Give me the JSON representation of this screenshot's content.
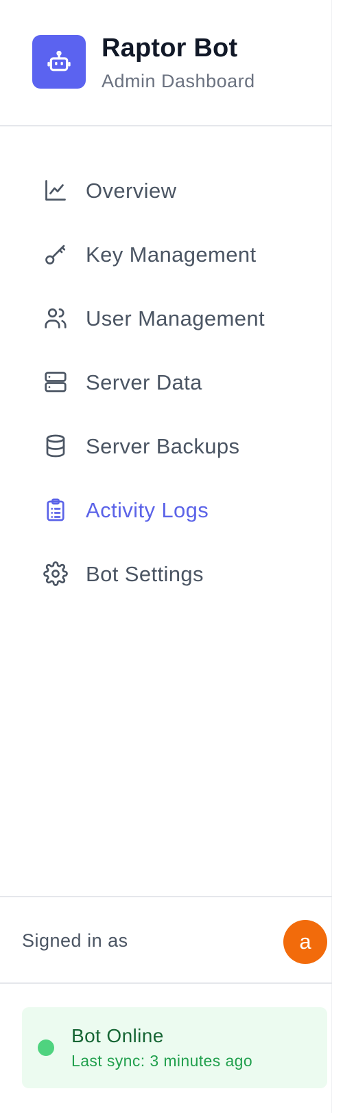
{
  "brand": {
    "title": "Raptor Bot",
    "subtitle": "Admin Dashboard",
    "logo_icon": "robot-icon",
    "accent_color": "#5b63f0"
  },
  "nav": {
    "items": [
      {
        "label": "Overview",
        "icon": "chart-line-icon",
        "active": false
      },
      {
        "label": "Key Management",
        "icon": "key-icon",
        "active": false
      },
      {
        "label": "User Management",
        "icon": "users-icon",
        "active": false
      },
      {
        "label": "Server Data",
        "icon": "server-icon",
        "active": false
      },
      {
        "label": "Server Backups",
        "icon": "database-icon",
        "active": false
      },
      {
        "label": "Activity Logs",
        "icon": "clipboard-list-icon",
        "active": true
      },
      {
        "label": "Bot Settings",
        "icon": "gear-icon",
        "active": false
      }
    ],
    "text_color": "#4b5563",
    "active_color": "#5b63e8"
  },
  "user": {
    "signed_in_label": "Signed in as",
    "avatar_initial": "a",
    "avatar_color": "#f26b0b"
  },
  "status": {
    "title": "Bot Online",
    "subtitle": "Last sync: 3 minutes ago",
    "dot_color": "#4fd37f",
    "background_color": "#ecfbf0"
  }
}
